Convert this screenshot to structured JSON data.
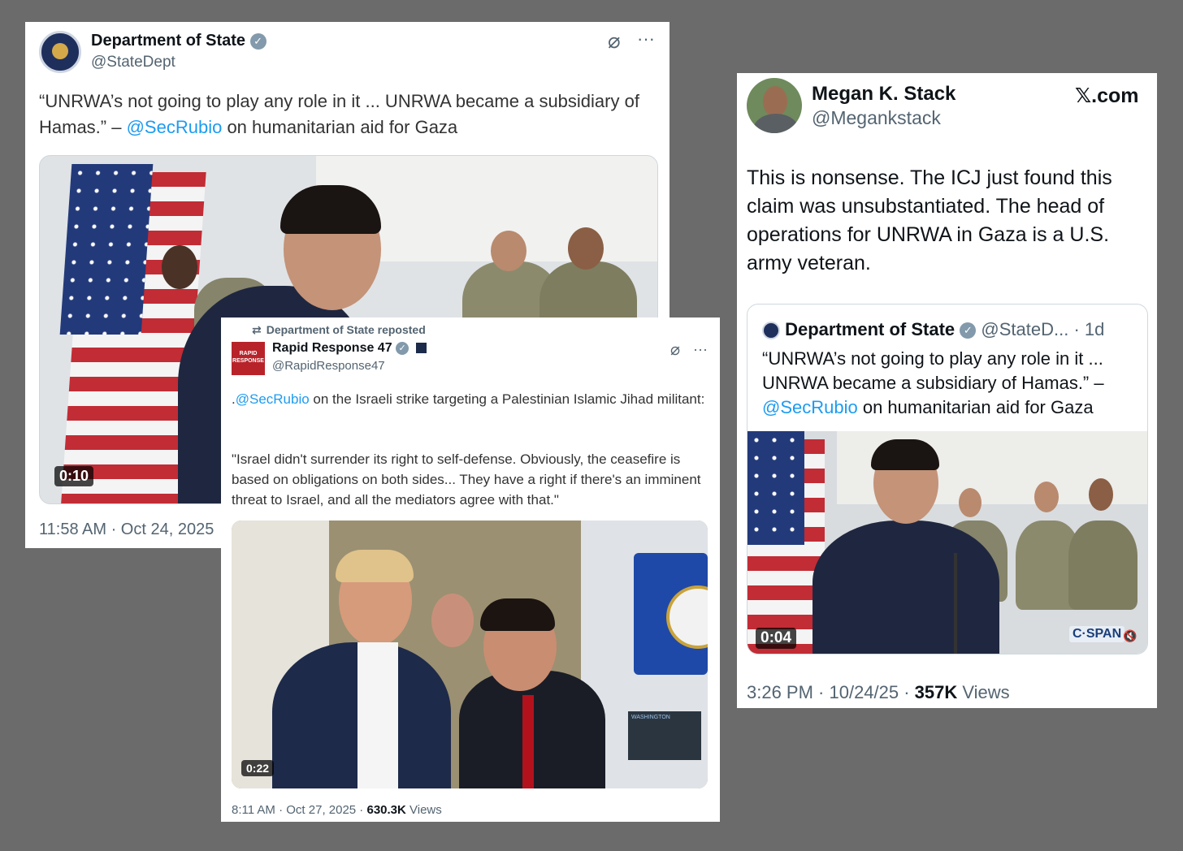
{
  "tweet1": {
    "author_name": "Department of State",
    "handle": "@StateDept",
    "text_before": "“UNRWA’s not going to play any role in it ... UNRWA became a subsidiary of Hamas.” – ",
    "mention": "@SecRubio",
    "text_after": " on humanitarian aid for Gaza",
    "video_time": "0:10",
    "timestamp": "11:58 AM · Oct 24, 2025"
  },
  "tweet2": {
    "repost_label": "Department of State reposted",
    "author_name": "Rapid Response 47",
    "handle": "@RapidResponse47",
    "avatar_text": "RAPID RESPONSE",
    "text_lead": ".",
    "mention": "@SecRubio",
    "text_line1_rest": " on the Israeli strike targeting a Palestinian Islamic Jihad militant:",
    "quote": "\"Israel didn't surrender its right to self-defense. Obviously, the ceasefire is based on obligations on both sides... They have a right if there's an imminent threat to Israel, and all the mediators agree with that.\"",
    "video_time": "0:22",
    "screen_text": "WASHINGTON",
    "timestamp": "8:11 AM · Oct 27, 2025 · ",
    "views_count": "630.3K",
    "views_label": " Views"
  },
  "tweet3": {
    "author_name": "Megan K. Stack",
    "handle": "@Megankstack",
    "site_label": "𝕏.com",
    "text": "This is nonsense. The ICJ just found this claim was unsubstantiated. The head of operations for UNRWA in Gaza is a U.S. army veteran.",
    "quoted": {
      "author_name": "Department of State",
      "handle_time": "@StateD... · 1d",
      "text_before": "“UNRWA’s not going to play any role in it ... UNRWA became a subsidiary of Hamas.” – ",
      "mention": "@SecRubio",
      "text_after": " on humanitarian aid for Gaza",
      "video_time": "0:04",
      "network_logo": "C·SPAN"
    },
    "timestamp": "3:26 PM · 10/24/25 · ",
    "views_count": "357K",
    "views_label": " Views"
  },
  "icons": {
    "grok": "⌀",
    "more": "···",
    "repost": "⇄",
    "mute": "🔇"
  },
  "colors": {
    "link_blue": "#1d9bf0",
    "background": "#6b6b6b"
  }
}
